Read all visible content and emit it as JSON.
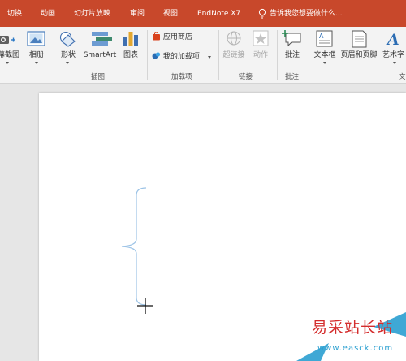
{
  "tabs": [
    {
      "label": "切换"
    },
    {
      "label": "动画"
    },
    {
      "label": "幻灯片放映"
    },
    {
      "label": "审阅"
    },
    {
      "label": "视图"
    },
    {
      "label": "EndNote X7"
    }
  ],
  "tell_me": {
    "placeholder": "告诉我您想要做什么..."
  },
  "ribbon": {
    "images": {
      "screenshot_label": "屏幕截图",
      "album_label": "相册"
    },
    "illustrations": {
      "shapes_label": "形状",
      "smartart_label": "SmartArt",
      "chart_label": "图表",
      "group_label": "插图"
    },
    "addins": {
      "store_label": "应用商店",
      "my_addins_label": "我的加载项",
      "group_label": "加载项"
    },
    "links": {
      "hyperlink_label": "超链接",
      "action_label": "动作",
      "group_label": "链接"
    },
    "comments": {
      "comment_label": "批注",
      "group_label": "批注"
    },
    "text": {
      "textbox_label": "文本框",
      "header_footer_label": "页眉和页脚",
      "wordart_label": "艺术字",
      "group_label": "文"
    }
  },
  "watermark": {
    "name": "易采站长站",
    "url": "www.easck.com"
  },
  "colors": {
    "tab_bar": "#c8482b",
    "ribbon_bg": "#f3f3f3",
    "brace": "#9cc3e6",
    "watermark_red": "#d42c2c",
    "watermark_blue": "#2a9fd0"
  }
}
